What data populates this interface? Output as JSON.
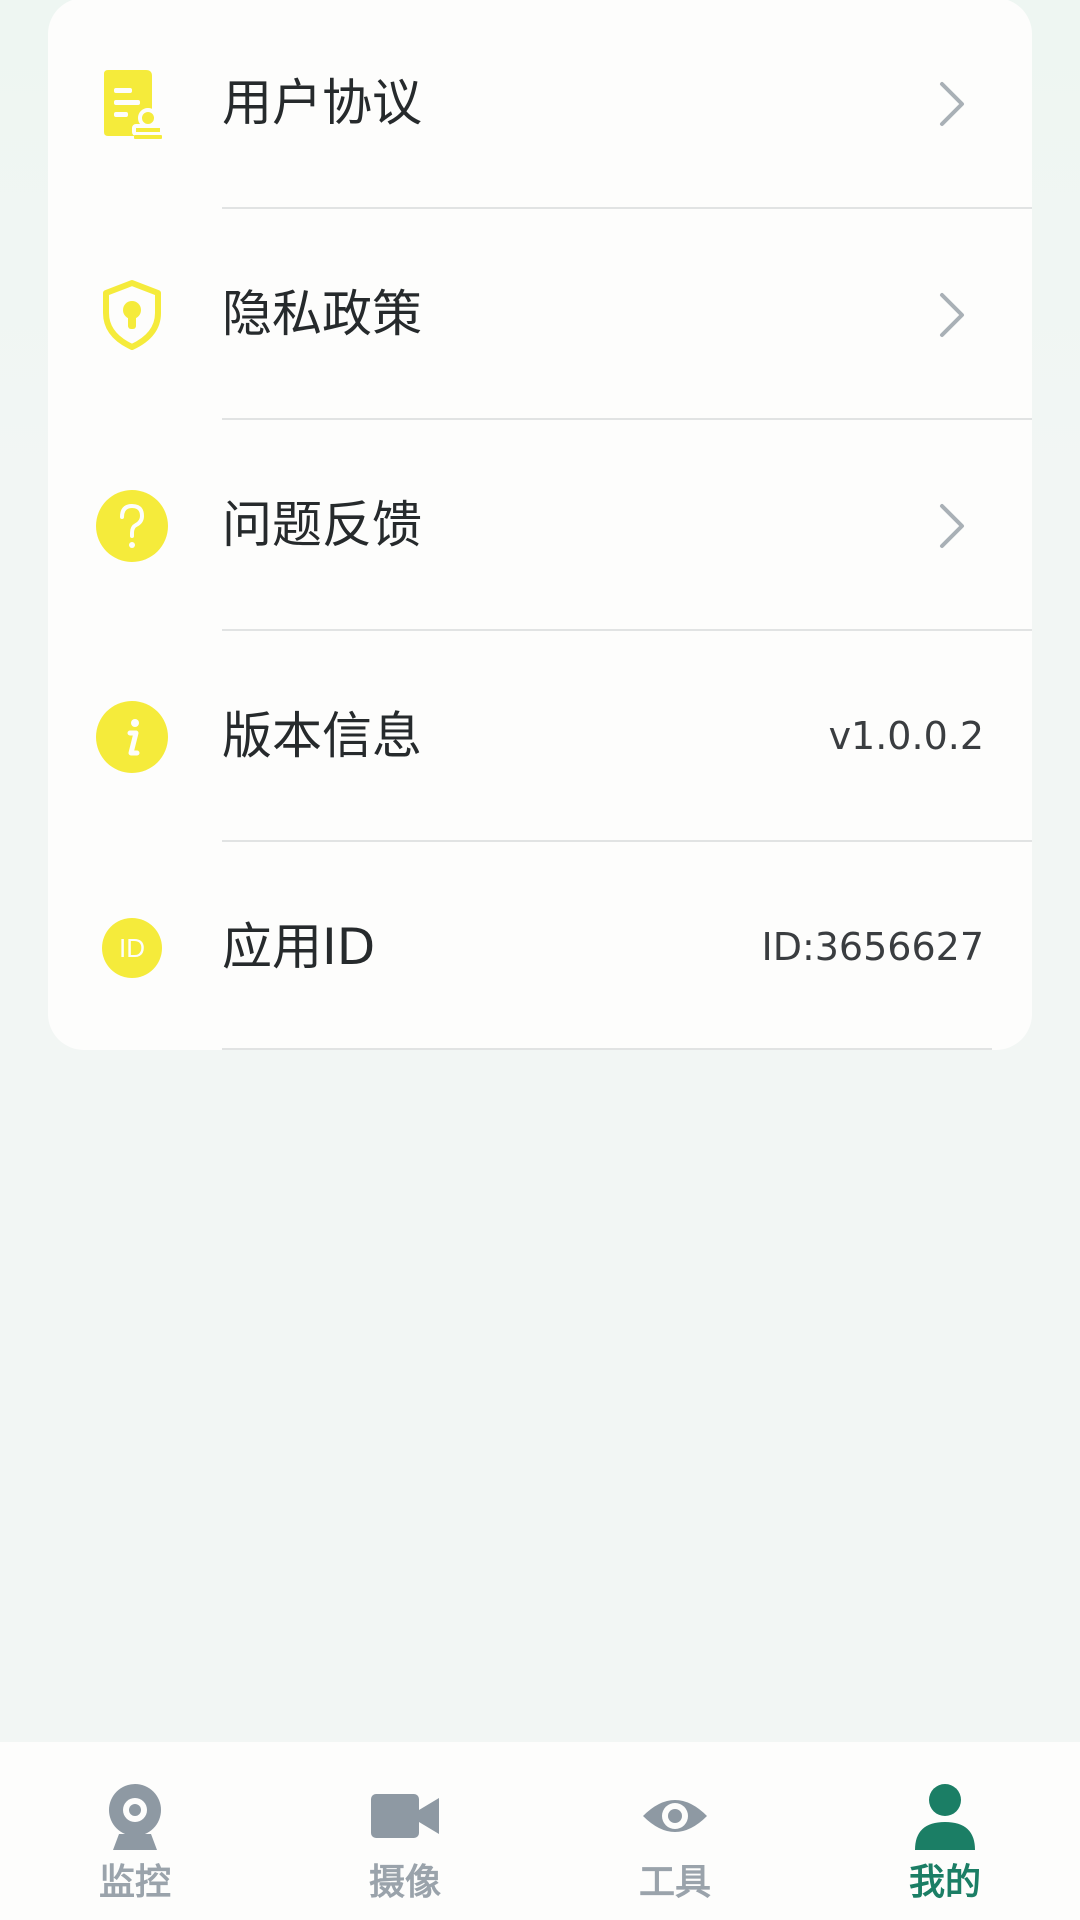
{
  "colors": {
    "accent": "#1b7e65",
    "icon_yellow": "#f5eb3b",
    "tab_inactive": "#8e99a3"
  },
  "menu": {
    "items": [
      {
        "label": "用户协议",
        "icon": "document-stamp-icon",
        "value": "",
        "has_chevron": true
      },
      {
        "label": "隐私政策",
        "icon": "shield-lock-icon",
        "value": "",
        "has_chevron": true
      },
      {
        "label": "问题反馈",
        "icon": "question-circle-icon",
        "value": "",
        "has_chevron": true
      },
      {
        "label": "版本信息",
        "icon": "info-circle-icon",
        "value": "v1.0.0.2",
        "has_chevron": false
      },
      {
        "label": "应用ID",
        "icon": "id-badge-icon",
        "value": "ID:3656627",
        "has_chevron": false
      }
    ],
    "id_badge_text": "ID"
  },
  "tabbar": {
    "tabs": [
      {
        "label": "监控",
        "icon": "webcam-icon",
        "active": false
      },
      {
        "label": "摄像",
        "icon": "video-camera-icon",
        "active": false
      },
      {
        "label": "工具",
        "icon": "eye-icon",
        "active": false
      },
      {
        "label": "我的",
        "icon": "person-icon",
        "active": true
      }
    ]
  }
}
